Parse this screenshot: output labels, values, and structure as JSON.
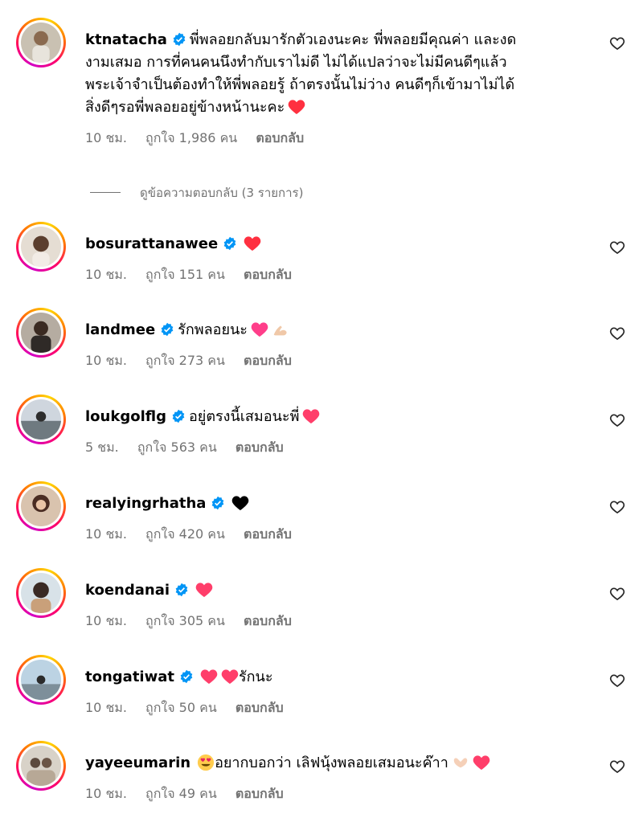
{
  "comments": [
    {
      "username": "ktnatacha",
      "lines": [
        "พี่พลอยกลับมารักตัวเองนะคะ พี่พลอยมีคุณค่า และงด",
        "งามเสมอ การที่คนคนนึงทำกับเราไม่ดี ไม่ได้แปลว่าจะไม่มีคนดีๆแล้ว",
        "พระเจ้าจำเป็นต้องทำให้พี่พลอยรู้ ถ้าตรงนั้นไม่ว่าง คนดีๆก็เข้ามาไม่ได้",
        "สิ่งดีๆรอพี่พลอยอยู่ข้างหน้านะคะ"
      ],
      "time": "10 ชม.",
      "likes": "ถูกใจ 1,986 คน",
      "reply": "ตอบกลับ"
    },
    {
      "username": "bosurattanawee",
      "text": "",
      "time": "10 ชม.",
      "likes": "ถูกใจ 151 คน",
      "reply": "ตอบกลับ"
    },
    {
      "username": "landmee",
      "text": "รักพลอยนะ",
      "time": "10 ชม.",
      "likes": "ถูกใจ 273 คน",
      "reply": "ตอบกลับ"
    },
    {
      "username": "loukgolflg",
      "text": "อยู่ตรงนี้เสมอนะพี่",
      "time": "5 ชม.",
      "likes": "ถูกใจ 563 คน",
      "reply": "ตอบกลับ"
    },
    {
      "username": "realyingrhatha",
      "text": "",
      "time": "10 ชม.",
      "likes": "ถูกใจ 420 คน",
      "reply": "ตอบกลับ"
    },
    {
      "username": "koendanai",
      "text": "",
      "time": "10 ชม.",
      "likes": "ถูกใจ 305 คน",
      "reply": "ตอบกลับ"
    },
    {
      "username": "tongatiwat",
      "text": "รักนะ",
      "time": "10 ชม.",
      "likes": "ถูกใจ 50 คน",
      "reply": "ตอบกลับ"
    },
    {
      "username": "yayeeumarin",
      "text": "อยากบอกว่า เลิฟนุ้งพลอยเสมอนะค๊าา",
      "time": "10 ชม.",
      "likes": "ถูกใจ 49 คน",
      "reply": "ตอบกลับ"
    }
  ],
  "view_replies": "ดูข้อความตอบกลับ (3 รายการ)",
  "colors": {
    "meta": "#737373",
    "verified": "#0095f6",
    "heart": "#ff3040"
  }
}
